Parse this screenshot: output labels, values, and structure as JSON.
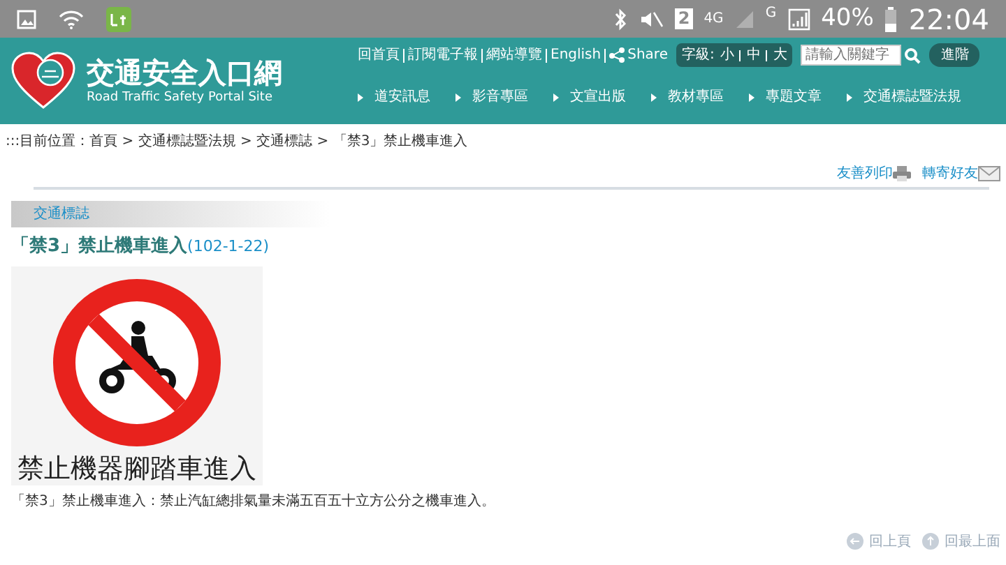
{
  "status_bar": {
    "sim_slot": "2",
    "network": "4G",
    "network_2": "G",
    "battery": "40%",
    "time": "22:04"
  },
  "header": {
    "site_title": "交通安全入口網",
    "site_subtitle": "Road Traffic Safety Portal Site",
    "top_links": [
      "回首頁",
      "訂閱電子報",
      "網站導覽",
      "English"
    ],
    "share": "Share",
    "font_size": {
      "label": "字級:",
      "options": [
        "小",
        "中",
        "大"
      ]
    },
    "search": {
      "placeholder": "請輸入關鍵字"
    },
    "advanced": "進階",
    "nav": [
      "道安訊息",
      "影音專區",
      "文宣出版",
      "教材專區",
      "專題文章",
      "交通標誌暨法規"
    ]
  },
  "breadcrumb": ":::目前位置：首頁 > 交通標誌暨法規 > 交通標誌 > 「禁3」禁止機車進入",
  "actions": [
    "友善列印",
    "轉寄好友"
  ],
  "section": "交通標誌",
  "article": {
    "title": "「禁3」禁止機車進入",
    "date": "(102-1-22)",
    "sign_caption": "禁止機器腳踏車進入",
    "description": "「禁3」禁止機車進入：禁止汽缸總排氣量未滿五百五十立方公分之機車進入。"
  },
  "footer_links": [
    "回上頁",
    "回最上面"
  ]
}
